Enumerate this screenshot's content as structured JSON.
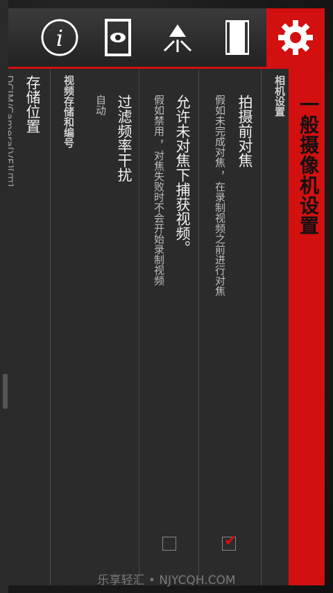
{
  "toolbar": {
    "icons": [
      "info-icon",
      "eye-icon",
      "flash-icon",
      "film-icon",
      "settings-gear-icon"
    ],
    "info_glyph": "i"
  },
  "panel": {
    "title": "一般摄像机设置",
    "section_camera": "相机设置",
    "items": [
      {
        "title": "拍摄前对焦",
        "subtitle": "假如未完成对焦 ，在录制视频之前进行对焦",
        "checked": true
      },
      {
        "title": "允许未对焦下捕获视频。",
        "subtitle": "假如禁用 ，对焦失败时不会开始录制视频",
        "checked": false
      },
      {
        "title": "过滤频率干扰",
        "subtitle": "自动"
      }
    ],
    "section_storage": "视频存储和编号",
    "storage_title": "存储位置",
    "storage_sub_partial": "DCIM/Camera[VF][日]"
  },
  "colors": {
    "accent": "#d21010",
    "panel": "#2b2b2b"
  },
  "watermark": "乐享轻汇 • NJYCQH.COM"
}
